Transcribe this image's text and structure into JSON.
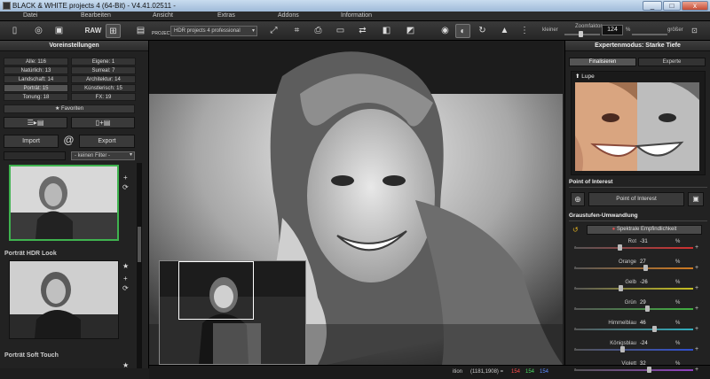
{
  "window": {
    "title": "BLACK & WHITE projects 4 (64-Bit) - V4.41.02511 -",
    "min": "_",
    "max": "□",
    "close": "x"
  },
  "menu": [
    "Datei",
    "Bearbeiten",
    "Ansicht",
    "Extras",
    "Addons",
    "Information"
  ],
  "toolbar": {
    "raw_label": "RAW",
    "projects_label": "PROJECTS",
    "preset_select": "HDR projects 4 professional",
    "kleiner_label": "kleiner",
    "groesser_label": "größer",
    "zoom_label": "Zoomfaktor",
    "zoom_value": "124",
    "zoom_unit": "%"
  },
  "left_panel": {
    "title": "Voreinstellungen",
    "categories": [
      "Alle: 116",
      "Eigene: 1",
      "Natürlich: 13",
      "Surreal: 7",
      "Landschaft: 14",
      "Architektur: 14",
      "Porträt: 15",
      "Künstlerisch: 15",
      "Tonung: 18",
      "FX: 19"
    ],
    "selected_category_index": 6,
    "favorites_label": "Favoriten",
    "import_label": "Import",
    "export_label": "Export",
    "at_label": "@",
    "filter_value": "- keinen Filter -",
    "presets": [
      {
        "title": ""
      },
      {
        "title": "Porträt HDR Look"
      },
      {
        "title": "Porträt Soft Touch"
      }
    ]
  },
  "status": {
    "label": "ition",
    "coords": "(1181,1908) =",
    "r": "154",
    "g": "154",
    "b": "154",
    "r_color": "#ff4c4c",
    "g_color": "#4cd964",
    "b_color": "#5a8cff"
  },
  "right_panel": {
    "title": "Expertenmodus: Starke Tiefe",
    "tabs": [
      "Finalisieren",
      "Experte"
    ],
    "lupe_label": "Lupe",
    "poi_section": "Point of Interest",
    "poi_button": "Point of Interest",
    "grey_section": "Graustufen-Umwandlung",
    "spectral_button": "Spektrale Empfindlichkeit",
    "channels": [
      {
        "name": "Rot",
        "value": "-31",
        "pos": 0.38,
        "color": "#d03030"
      },
      {
        "name": "Orange",
        "value": "27",
        "pos": 0.6,
        "color": "#d07a20"
      },
      {
        "name": "Gelb",
        "value": "-26",
        "pos": 0.39,
        "color": "#c8c020"
      },
      {
        "name": "Grün",
        "value": "29",
        "pos": 0.61,
        "color": "#40b040"
      },
      {
        "name": "Himmelblau",
        "value": "46",
        "pos": 0.67,
        "color": "#30b0c0"
      },
      {
        "name": "Königsblau",
        "value": "-24",
        "pos": 0.4,
        "color": "#3050d0"
      },
      {
        "name": "Violett",
        "value": "32",
        "pos": 0.63,
        "color": "#9040c0"
      }
    ],
    "pct": "%",
    "plus": "+",
    "minus": "-"
  }
}
